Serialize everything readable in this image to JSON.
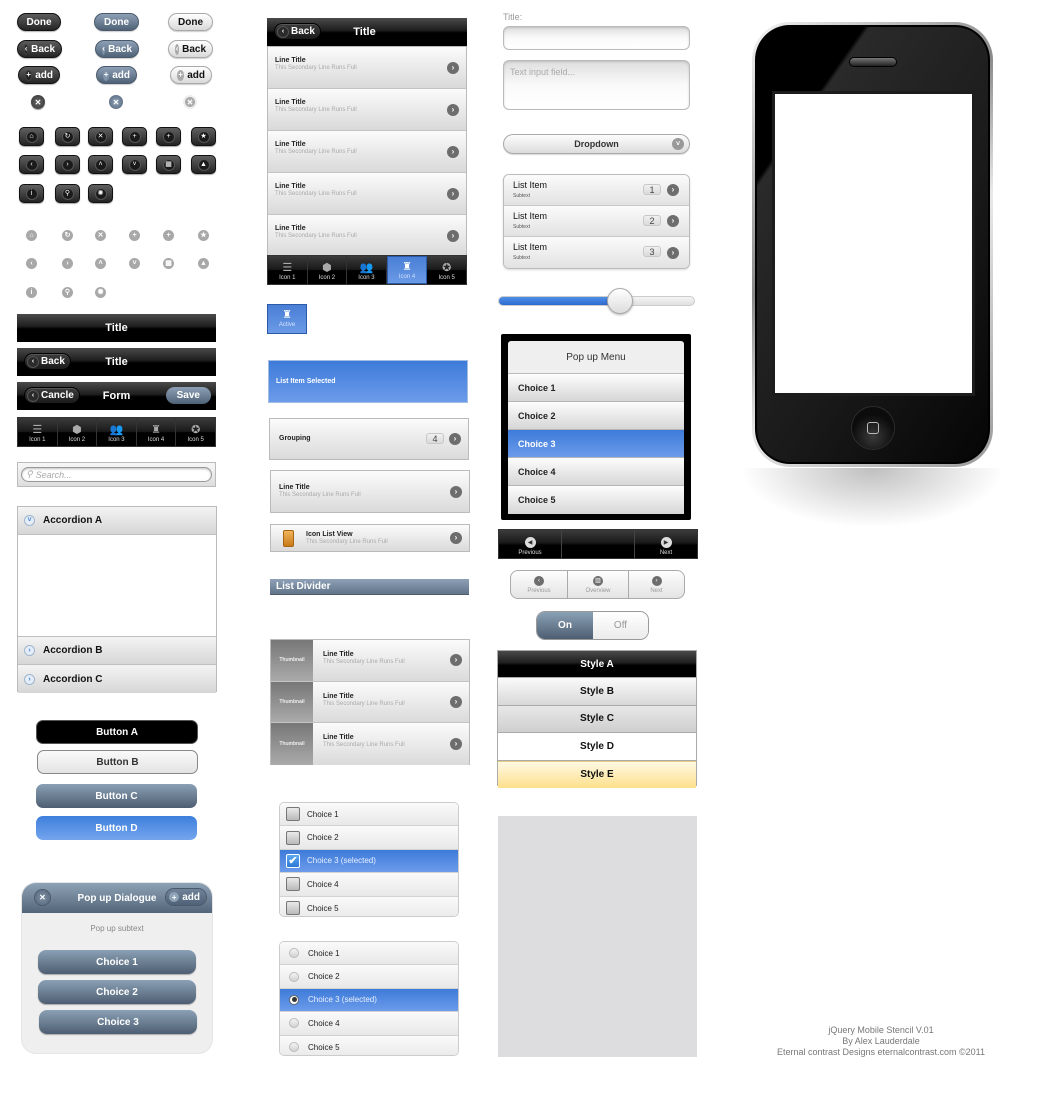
{
  "pill_buttons": {
    "done": "Done",
    "back": "Back",
    "add": "add"
  },
  "icon_buttons": [
    "home",
    "refresh",
    "delete",
    "plus",
    "plus",
    "star",
    "arrow-left",
    "arrow-right",
    "arrow-up",
    "arrow-down",
    "grid",
    "alert",
    "info",
    "search",
    "gear"
  ],
  "icon_glyphs": {
    "home": "⌂",
    "refresh": "↻",
    "delete": "✕",
    "plus": "+",
    "star": "★",
    "arrow-left": "‹",
    "arrow-right": "›",
    "arrow-up": "˄",
    "arrow-down": "˅",
    "grid": "▦",
    "alert": "▲",
    "info": "i",
    "search": "⚲",
    "gear": "✺"
  },
  "headers": {
    "title": "Title",
    "back": "Back",
    "cancel": "Cancle",
    "form": "Form",
    "save": "Save"
  },
  "tabbar": {
    "tabs": [
      {
        "label": "Icon 1",
        "icon": "☰"
      },
      {
        "label": "Icon 2",
        "icon": "⬢"
      },
      {
        "label": "Icon 3",
        "icon": "👥"
      },
      {
        "label": "Icon 4",
        "icon": "♜"
      },
      {
        "label": "Icon 5",
        "icon": "✪"
      }
    ],
    "active_index_listview": 3,
    "active_label": "Active"
  },
  "search": {
    "placeholder": "Search..."
  },
  "accordion": {
    "sections": [
      "Accordion A",
      "Accordion B",
      "Accordion C"
    ],
    "expanded": "Accordion A"
  },
  "buttons": [
    "Button A",
    "Button B",
    "Button C",
    "Button D"
  ],
  "dialog": {
    "title": "Pop up Dialogue",
    "add": "add",
    "subtext": "Pop up subtext",
    "choices": [
      "Choice 1",
      "Choice 2",
      "Choice 3"
    ]
  },
  "listview": {
    "header_back": "Back",
    "header_title": "Title",
    "rows": [
      {
        "title": "Line Title",
        "subtitle": "This Secondary Line Runs Full"
      },
      {
        "title": "Line Title",
        "subtitle": "This Secondary Line Runs Full"
      },
      {
        "title": "Line Title",
        "subtitle": "This Secondary Line Runs Full"
      },
      {
        "title": "Line Title",
        "subtitle": "This Secondary Line Runs Full"
      },
      {
        "title": "Line Title",
        "subtitle": "This Secondary Line Runs Full"
      }
    ]
  },
  "list_item_selected": "List Item Selected",
  "grouping": {
    "label": "Grouping",
    "count": "4"
  },
  "single_line": {
    "title": "Line Title",
    "subtitle": "This Secondary Line Runs Full"
  },
  "icon_list": {
    "title": "Icon List View",
    "subtitle": "This Secondary Line Runs Full"
  },
  "list_divider": "List Divider",
  "thumb_list": {
    "thumb_label": "Thumbnail",
    "rows": [
      {
        "title": "Line Title",
        "subtitle": "This Secondary Line Runs Full"
      },
      {
        "title": "Line Title",
        "subtitle": "This Secondary Line Runs Full"
      },
      {
        "title": "Line Title",
        "subtitle": "This Secondary Line Runs Full"
      }
    ]
  },
  "checkbox_list": {
    "items": [
      "Choice 1",
      "Choice 2",
      "Choice 3 (selected)",
      "Choice 4",
      "Choice 5"
    ],
    "selected_index": 2
  },
  "radio_list": {
    "items": [
      "Choice 1",
      "Choice 2",
      "Choice 3 (selected)",
      "Choice 4",
      "Choice 5"
    ],
    "selected_index": 2
  },
  "form": {
    "title_label": "Title:",
    "title_value": "",
    "textarea_placeholder": "Text input field...",
    "dropdown": "Dropdown"
  },
  "inset_list": [
    {
      "title": "List Item",
      "subtext": "Subtext",
      "count": "1"
    },
    {
      "title": "List Item",
      "subtext": "Subtext",
      "count": "2"
    },
    {
      "title": "List Item",
      "subtext": "Subtext",
      "count": "3"
    }
  ],
  "slider": {
    "value_percent": 62
  },
  "popup_menu": {
    "title": "Pop up Menu",
    "items": [
      "Choice 1",
      "Choice 2",
      "Choice 3",
      "Choice 4",
      "Choice 5"
    ],
    "selected_index": 2
  },
  "nav_dark": {
    "previous": "Previous",
    "next": "Next"
  },
  "nav_segmented": {
    "previous": "Previous",
    "overview": "Overview",
    "next": "Next"
  },
  "toggle": {
    "on": "On",
    "off": "Off",
    "state": "On"
  },
  "styles": [
    "Style A",
    "Style B",
    "Style C",
    "Style D",
    "Style E"
  ],
  "credits": {
    "line1": "jQuery Mobile Stencil V.01",
    "line2": "By Alex Lauderdale",
    "line3": "Eternal contrast Designs  eternalcontrast.com  ©2011"
  },
  "colors": {
    "accent_blue": "#4a7fd6",
    "slate": "#536579",
    "dark": "#000000",
    "style_e": "#fde08c"
  }
}
